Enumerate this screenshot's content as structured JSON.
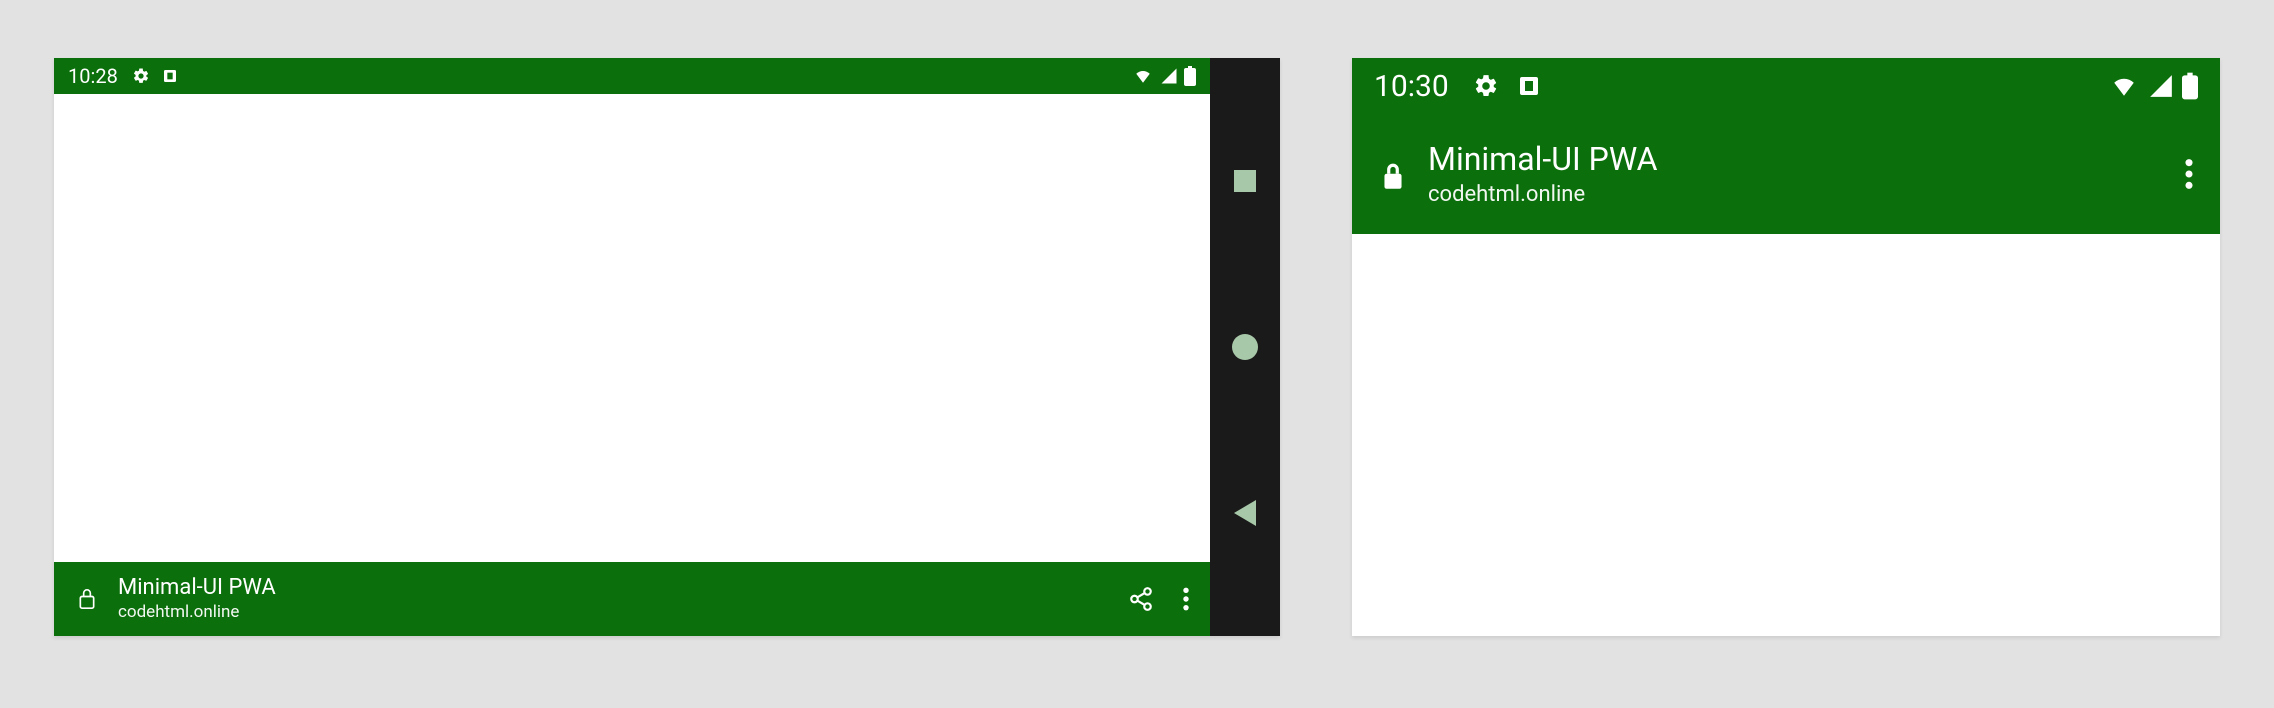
{
  "left": {
    "statusbar": {
      "time": "10:28"
    },
    "appbar": {
      "title": "Minimal-UI PWA",
      "subtitle": "codehtml.online"
    }
  },
  "right": {
    "statusbar": {
      "time": "10:30"
    },
    "appbar": {
      "title": "Minimal-UI PWA",
      "subtitle": "codehtml.online"
    }
  }
}
